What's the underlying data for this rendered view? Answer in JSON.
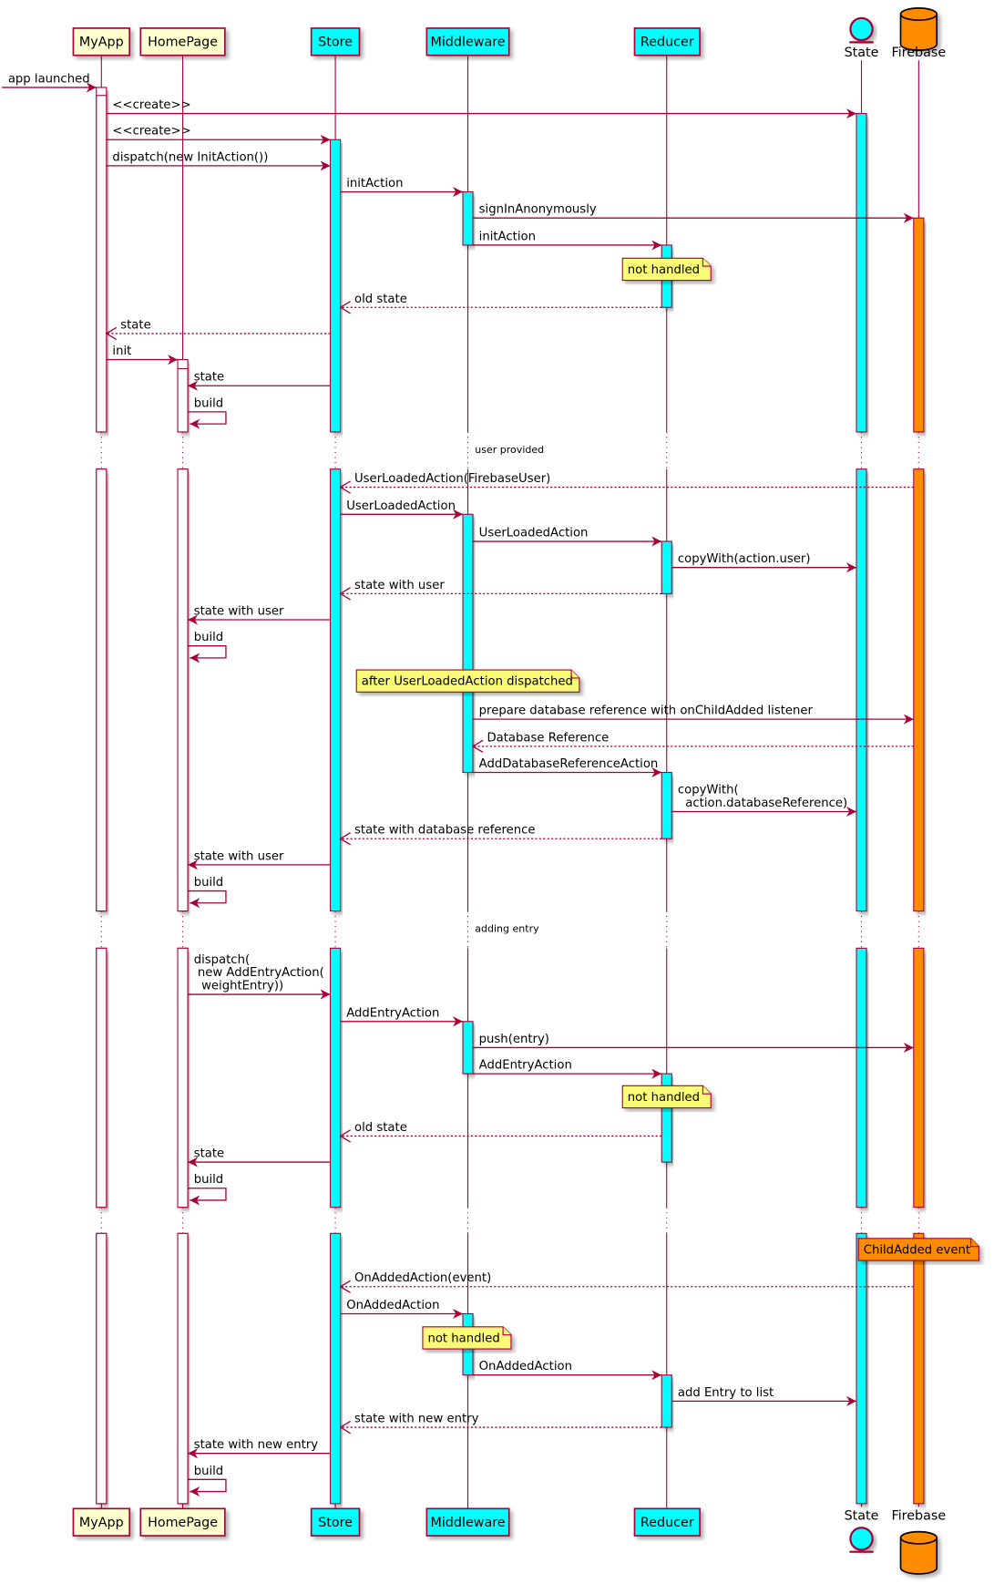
{
  "colors": {
    "line": "#A80036",
    "participant_default": "#FEFECE",
    "participant_accent": "#00FFFF",
    "firebase": "#FF8C00",
    "note": "#FBFB77",
    "shadow": "#C0C0C0"
  },
  "participants": [
    {
      "id": "myapp",
      "label": "MyApp",
      "kind": "box",
      "fill": "#FEFECE"
    },
    {
      "id": "homepage",
      "label": "HomePage",
      "kind": "box",
      "fill": "#FEFECE"
    },
    {
      "id": "store",
      "label": "Store",
      "kind": "box",
      "fill": "#00FFFF"
    },
    {
      "id": "middleware",
      "label": "Middleware",
      "kind": "box",
      "fill": "#00FFFF"
    },
    {
      "id": "reducer",
      "label": "Reducer",
      "kind": "box",
      "fill": "#00FFFF"
    },
    {
      "id": "state",
      "label": "State",
      "kind": "entity",
      "fill": "#00FFFF"
    },
    {
      "id": "firebase",
      "label": "Firebase",
      "kind": "database",
      "fill": "#FF8C00"
    }
  ],
  "dividers": [
    {
      "label": "user provided"
    },
    {
      "label": "adding entry"
    },
    {
      "label": ""
    }
  ],
  "messages": [
    {
      "from": "start",
      "to": "myapp",
      "label": "app launched",
      "dashed": false
    },
    {
      "from": "myapp",
      "to": "state",
      "label": "<<create>>",
      "dashed": false
    },
    {
      "from": "myapp",
      "to": "store",
      "label": "<<create>>",
      "dashed": false
    },
    {
      "from": "myapp",
      "to": "store",
      "label": "dispatch(new InitAction())",
      "dashed": false
    },
    {
      "from": "store",
      "to": "middleware",
      "label": "initAction",
      "dashed": false
    },
    {
      "from": "middleware",
      "to": "firebase",
      "label": "signInAnonymously",
      "dashed": false
    },
    {
      "from": "middleware",
      "to": "reducer",
      "label": "initAction",
      "dashed": false
    },
    {
      "from": "reducer",
      "to": "store",
      "label": "old state",
      "dashed": true
    },
    {
      "from": "store",
      "to": "myapp",
      "label": "state",
      "dashed": true
    },
    {
      "from": "myapp",
      "to": "homepage",
      "label": "init",
      "dashed": false
    },
    {
      "from": "store",
      "to": "homepage",
      "label": "state",
      "dashed": false
    },
    {
      "from": "homepage",
      "to": "homepage",
      "label": "build",
      "dashed": false
    },
    {
      "from": "firebase",
      "to": "store",
      "label": "UserLoadedAction(FirebaseUser)",
      "dashed": true
    },
    {
      "from": "store",
      "to": "middleware",
      "label": "UserLoadedAction",
      "dashed": false
    },
    {
      "from": "middleware",
      "to": "reducer",
      "label": "UserLoadedAction",
      "dashed": false
    },
    {
      "from": "reducer",
      "to": "state",
      "label": "copyWith(action.user)",
      "dashed": false
    },
    {
      "from": "reducer",
      "to": "store",
      "label": "state with user",
      "dashed": true
    },
    {
      "from": "store",
      "to": "homepage",
      "label": "state  with user",
      "dashed": false
    },
    {
      "from": "homepage",
      "to": "homepage",
      "label": "build",
      "dashed": false
    },
    {
      "from": "middleware",
      "to": "firebase",
      "label": "prepare database reference with onChildAdded listener",
      "dashed": false
    },
    {
      "from": "firebase",
      "to": "middleware",
      "label": "Database Reference",
      "dashed": true
    },
    {
      "from": "middleware",
      "to": "reducer",
      "label": "AddDatabaseReferenceAction",
      "dashed": false
    },
    {
      "from": "reducer",
      "to": "state",
      "label": "copyWith(\n  action.databaseReference)",
      "dashed": false
    },
    {
      "from": "reducer",
      "to": "store",
      "label": "state with database reference",
      "dashed": true
    },
    {
      "from": "store",
      "to": "homepage",
      "label": "state  with user",
      "dashed": false
    },
    {
      "from": "homepage",
      "to": "homepage",
      "label": "build",
      "dashed": false
    },
    {
      "from": "homepage",
      "to": "store",
      "label": "dispatch(\n new AddEntryAction(\n  weightEntry))",
      "dashed": false
    },
    {
      "from": "store",
      "to": "middleware",
      "label": "AddEntryAction",
      "dashed": false
    },
    {
      "from": "middleware",
      "to": "firebase",
      "label": "push(entry)",
      "dashed": false
    },
    {
      "from": "middleware",
      "to": "reducer",
      "label": "AddEntryAction",
      "dashed": false
    },
    {
      "from": "reducer",
      "to": "store",
      "label": "old state",
      "dashed": true
    },
    {
      "from": "store",
      "to": "homepage",
      "label": "state",
      "dashed": false
    },
    {
      "from": "homepage",
      "to": "homepage",
      "label": "build",
      "dashed": false
    },
    {
      "from": "firebase",
      "to": "store",
      "label": "OnAddedAction(event)",
      "dashed": true
    },
    {
      "from": "store",
      "to": "middleware",
      "label": "OnAddedAction",
      "dashed": false
    },
    {
      "from": "middleware",
      "to": "reducer",
      "label": "OnAddedAction",
      "dashed": false
    },
    {
      "from": "reducer",
      "to": "state",
      "label": "add Entry to list",
      "dashed": false
    },
    {
      "from": "reducer",
      "to": "store",
      "label": "state with new entry",
      "dashed": true
    },
    {
      "from": "store",
      "to": "homepage",
      "label": "state with new entry",
      "dashed": false
    },
    {
      "from": "homepage",
      "to": "homepage",
      "label": "build",
      "dashed": false
    }
  ],
  "notes": [
    {
      "label": "not handled",
      "over": "reducer",
      "fill": "#FBFB77"
    },
    {
      "label": "after UserLoadedAction dispatched",
      "over": "middleware",
      "fill": "#FBFB77"
    },
    {
      "label": "not handled",
      "over": "reducer",
      "fill": "#FBFB77"
    },
    {
      "label": "ChildAdded event",
      "over": "state-firebase",
      "fill": "#FF8C00"
    },
    {
      "label": "not handled",
      "over": "middleware",
      "fill": "#FBFB77"
    }
  ]
}
